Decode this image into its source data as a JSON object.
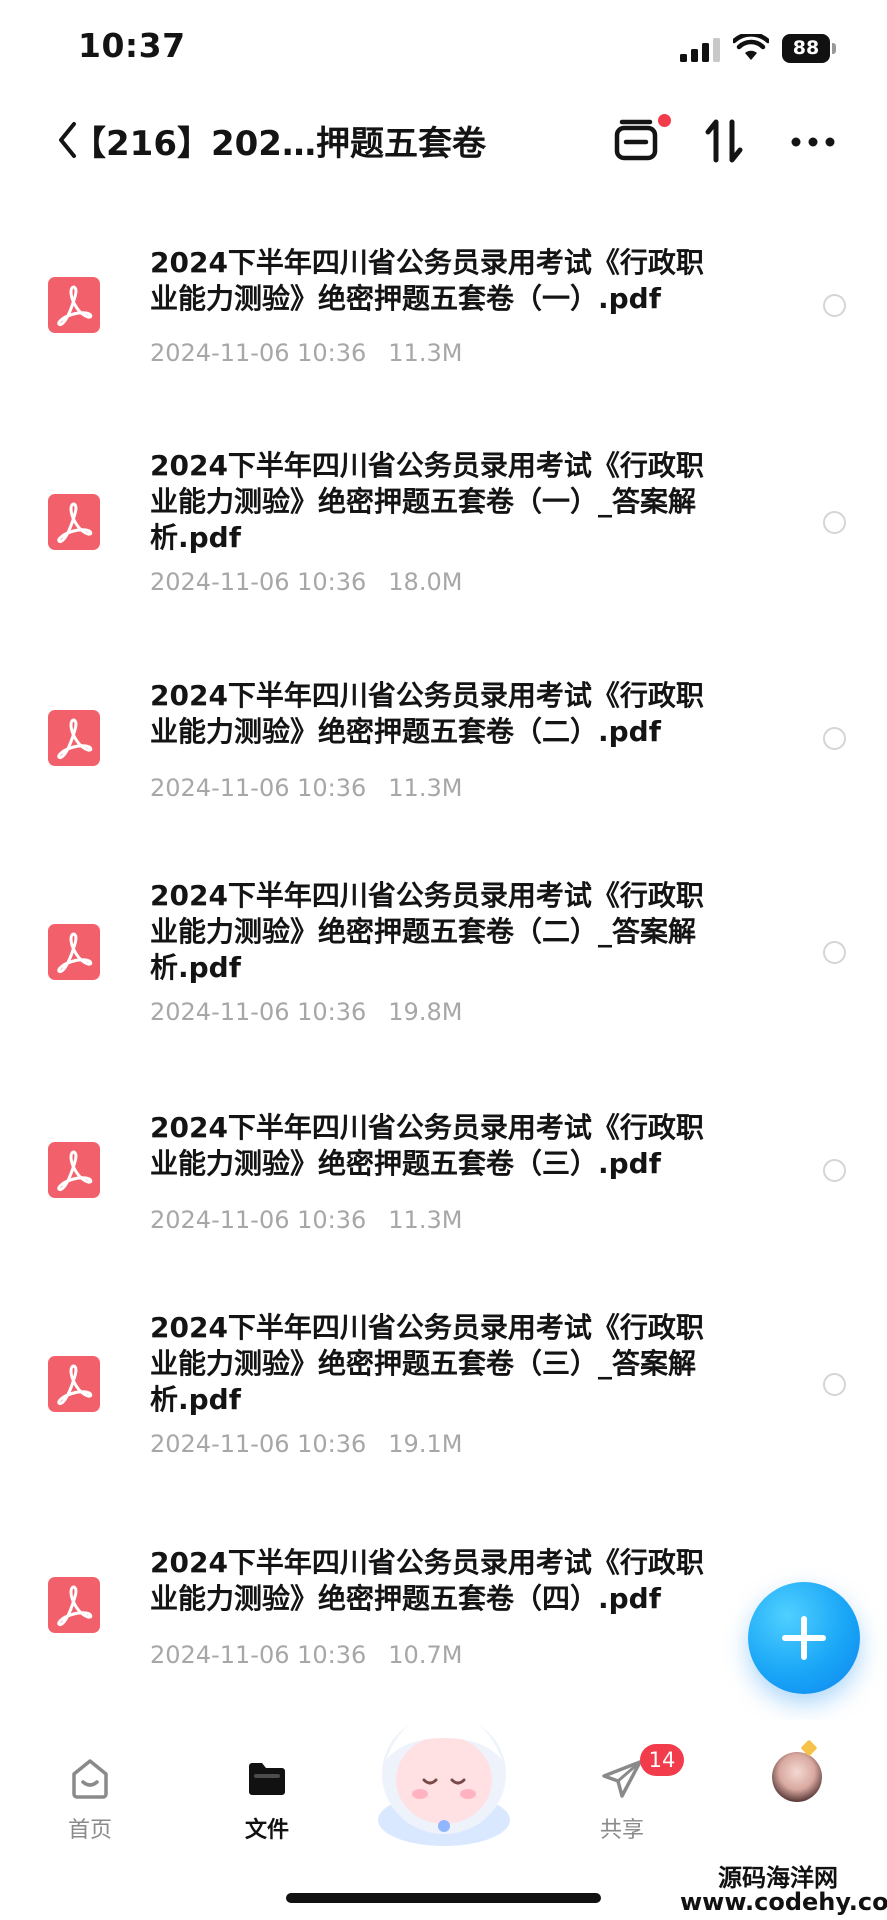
{
  "status_bar": {
    "time": "10:37",
    "battery": "88"
  },
  "nav": {
    "title": "【216】202…押题五套卷"
  },
  "files": [
    {
      "name": "2024下半年四川省公务员录用考试《行政职业能力测验》绝密押题五套卷（一）.pdf",
      "date": "2024-11-06 10:36",
      "size": "11.3M"
    },
    {
      "name": "2024下半年四川省公务员录用考试《行政职业能力测验》绝密押题五套卷（一）_答案解析.pdf",
      "date": "2024-11-06 10:36",
      "size": "18.0M"
    },
    {
      "name": "2024下半年四川省公务员录用考试《行政职业能力测验》绝密押题五套卷（二）.pdf",
      "date": "2024-11-06 10:36",
      "size": "11.3M"
    },
    {
      "name": "2024下半年四川省公务员录用考试《行政职业能力测验》绝密押题五套卷（二）_答案解析.pdf",
      "date": "2024-11-06 10:36",
      "size": "19.8M"
    },
    {
      "name": "2024下半年四川省公务员录用考试《行政职业能力测验》绝密押题五套卷（三）.pdf",
      "date": "2024-11-06 10:36",
      "size": "11.3M"
    },
    {
      "name": "2024下半年四川省公务员录用考试《行政职业能力测验》绝密押题五套卷（三）_答案解析.pdf",
      "date": "2024-11-06 10:36",
      "size": "19.1M"
    },
    {
      "name": "2024下半年四川省公务员录用考试《行政职业能力测验》绝密押题五套卷（四）.pdf",
      "date": "2024-11-06 10:36",
      "size": "10.7M"
    }
  ],
  "tabs": {
    "home": "首页",
    "files": "文件",
    "share": "共享",
    "share_badge": "14"
  },
  "watermark": {
    "text": "源码海洋网",
    "url": "www.codehy.com"
  },
  "colors": {
    "accent": "#1aa6f7",
    "pdf": "#f2616b",
    "badge": "#f23c4b"
  }
}
